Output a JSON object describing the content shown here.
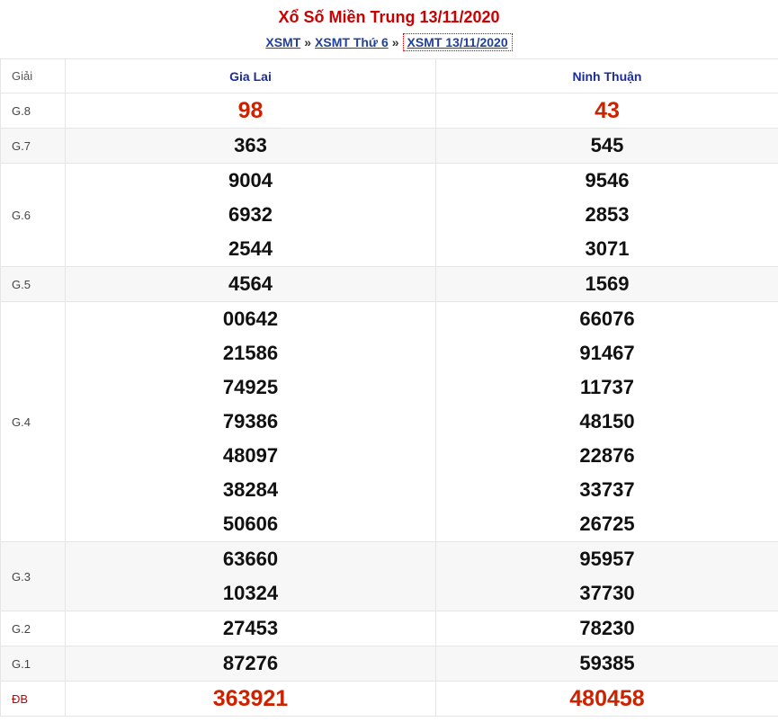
{
  "header": {
    "title": "Xổ Số Miền Trung 13/11/2020",
    "breadcrumb": [
      {
        "label": "XSMT"
      },
      {
        "label": "XSMT Thứ 6"
      },
      {
        "label": "XSMT 13/11/2020"
      }
    ],
    "separator": "»"
  },
  "table": {
    "columns": [
      "Giải",
      "Gia Lai",
      "Ninh Thuận"
    ],
    "rows": [
      {
        "label": "G.8",
        "gia_lai": [
          "98"
        ],
        "ninh_thuan": [
          "43"
        ]
      },
      {
        "label": "G.7",
        "gia_lai": [
          "363"
        ],
        "ninh_thuan": [
          "545"
        ]
      },
      {
        "label": "G.6",
        "gia_lai": [
          "9004",
          "6932",
          "2544"
        ],
        "ninh_thuan": [
          "9546",
          "2853",
          "3071"
        ]
      },
      {
        "label": "G.5",
        "gia_lai": [
          "4564"
        ],
        "ninh_thuan": [
          "1569"
        ]
      },
      {
        "label": "G.4",
        "gia_lai": [
          "00642",
          "21586",
          "74925",
          "79386",
          "48097",
          "38284",
          "50606"
        ],
        "ninh_thuan": [
          "66076",
          "91467",
          "11737",
          "48150",
          "22876",
          "33737",
          "26725"
        ]
      },
      {
        "label": "G.3",
        "gia_lai": [
          "63660",
          "10324"
        ],
        "ninh_thuan": [
          "95957",
          "37730"
        ]
      },
      {
        "label": "G.2",
        "gia_lai": [
          "27453"
        ],
        "ninh_thuan": [
          "78230"
        ]
      },
      {
        "label": "G.1",
        "gia_lai": [
          "87276"
        ],
        "ninh_thuan": [
          "59385"
        ]
      },
      {
        "label": "ĐB",
        "gia_lai": [
          "363921"
        ],
        "ninh_thuan": [
          "480458"
        ]
      }
    ]
  },
  "colors": {
    "title": "#cc0000",
    "link": "#21409a",
    "special_prize": "#cc2200"
  }
}
